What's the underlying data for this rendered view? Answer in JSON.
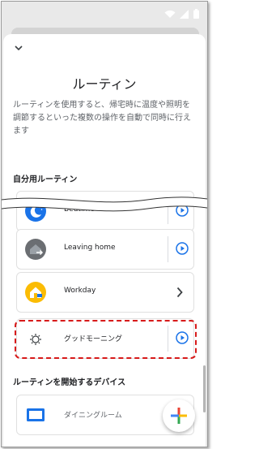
{
  "header": {
    "title": "ルーティン"
  },
  "description": "ルーティンを使用すると、帰宅時に温度や照明を調節するといった複数の操作を自動で同時に行えます",
  "sections": {
    "custom": {
      "label": "自分用ルーティン"
    },
    "devices": {
      "label": "ルーティンを開始するデバイス"
    }
  },
  "routines": [
    {
      "label": "Bedtime",
      "icon": "moon-icon"
    },
    {
      "label": "Leaving home",
      "icon": "house-leaving-icon"
    },
    {
      "label": "Workday",
      "icon": "house-work-icon"
    },
    {
      "label": "グッドモーニング",
      "icon": "sun-icon"
    }
  ],
  "devices": [
    {
      "label": "ダイニングルーム",
      "icon": "display-icon"
    }
  ],
  "colors": {
    "accent_blue": "#1a73e8",
    "highlight_red": "#d71a1a",
    "house_gray": "#6b6e72",
    "house_yellow": "#fbbc04"
  }
}
